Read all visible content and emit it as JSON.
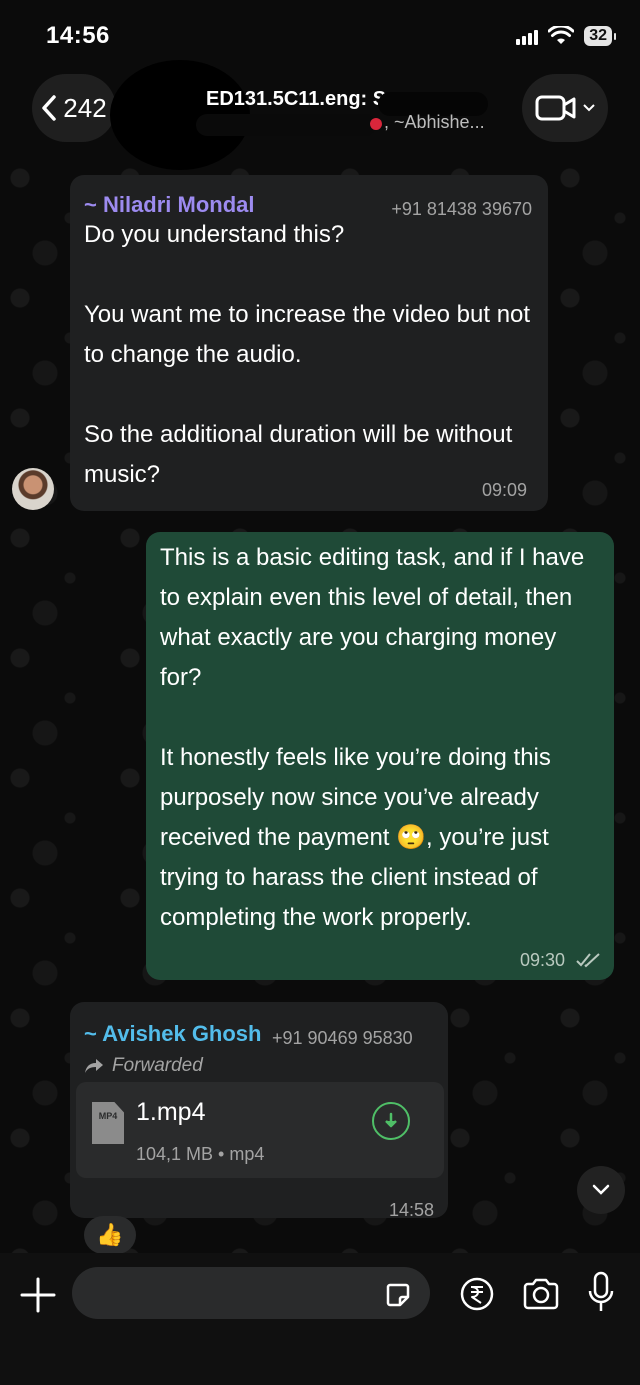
{
  "status_bar": {
    "time": "14:56",
    "battery": "32"
  },
  "header": {
    "back_count": "242",
    "title": "ED131.5C11.eng: S",
    "subtitle": ", ~Abhishe..."
  },
  "messages": [
    {
      "sender": "~ Niladri Mondal",
      "phone": "+91 81438 39670",
      "text": "Do you understand this?\n\nYou want me to increase the video but not to change the audio.\n\nSo the additional duration will be without music?",
      "time": "09:09"
    },
    {
      "text_before_emoji": "This is a basic editing task, and if I have to explain even this level of detail, then what exactly are you charging money for?\n\nIt honestly feels like you’re doing this purposely now since you’ve already received the payment ",
      "emoji": "🙄",
      "text_after_emoji": ", you’re just trying to harass the client instead of completing the work properly.",
      "time": "09:30"
    },
    {
      "sender": "~ Avishek Ghosh",
      "phone": "+91 90469 95830",
      "forwarded_label": "Forwarded",
      "file": {
        "icon_label": "MP4",
        "name": "1.mp4",
        "meta": "104,1 MB • mp4"
      },
      "time": "14:58",
      "reaction": "👍"
    }
  ],
  "input": {
    "placeholder": ""
  },
  "colors": {
    "outgoing": "#1f4a37",
    "incoming": "#1f2021",
    "accent_green": "#4fbf67",
    "sender1": "#9d8bf0",
    "sender2": "#53bdeb"
  }
}
